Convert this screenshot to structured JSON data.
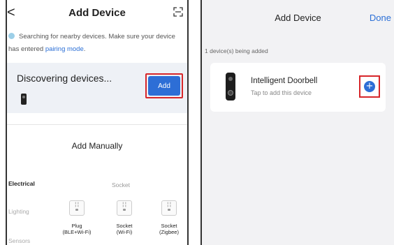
{
  "left_screen": {
    "title": "Add Device",
    "search_prefix": "Searching for nearby devices. Make sure your device has entered ",
    "pairing_link": "pairing mode",
    "search_suffix": ".",
    "discovering_text": "Discovering devices...",
    "add_label": "Add",
    "manual_title": "Add Manually",
    "categories": [
      "Electrical",
      "Lighting",
      "Sensors"
    ],
    "sub_heading": "Socket",
    "tiles": [
      {
        "line1": "Plug",
        "line2": "(BLE+Wi-Fi)"
      },
      {
        "line1": "Socket",
        "line2": "(Wi-Fi)"
      },
      {
        "line1": "Socket",
        "line2": "(Zigbee)"
      }
    ]
  },
  "right_screen": {
    "title": "Add Device",
    "done_label": "Done",
    "count_text": "1 device(s) being added",
    "device": {
      "name": "Intelligent Doorbell",
      "subtitle": "Tap to add this device"
    },
    "plus_label": "+"
  },
  "colors": {
    "accent": "#2d6ed6",
    "highlight": "#d7262a"
  },
  "icons": [
    "back-icon",
    "scan-icon",
    "spinner-icon",
    "doorbell-icon",
    "socket-icon",
    "plus-icon"
  ]
}
